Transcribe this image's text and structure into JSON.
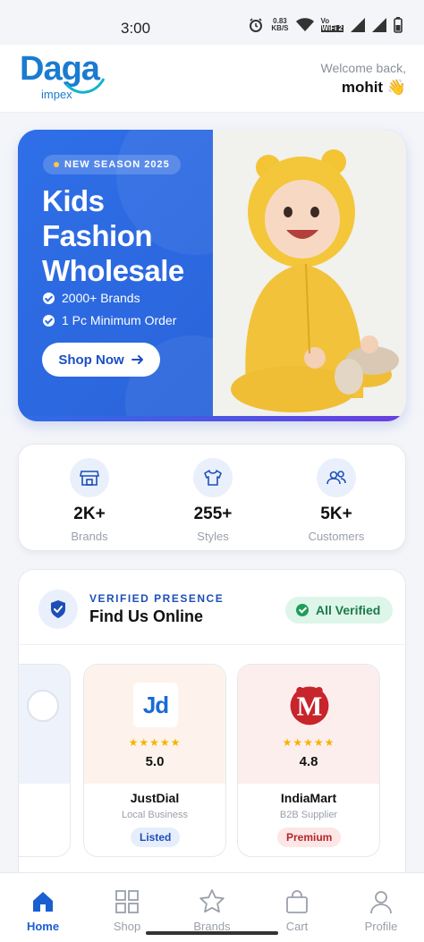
{
  "status_bar": {
    "time": "3:00",
    "net_speed_value": "0.83",
    "net_speed_unit": "KB/S",
    "wifi_label_top": "Vo",
    "wifi_label_bottom": "WiFi 2",
    "icons": [
      "alarm-icon",
      "wifi-icon",
      "vowifi-icon",
      "signal-icon",
      "signal-icon",
      "battery-icon"
    ]
  },
  "header": {
    "logo_main": "Daga",
    "logo_sub": "impex",
    "welcome_line": "Welcome back,",
    "username": "mohit 👋"
  },
  "hero": {
    "season_badge": "NEW SEASON 2025",
    "title_lines": [
      "Kids",
      "Fashion",
      "Wholesale"
    ],
    "features": [
      "2000+ Brands",
      "1 Pc Minimum Order"
    ],
    "cta_label": "Shop Now",
    "cta_icon": "arrow-right-icon",
    "colors": {
      "primary": "#2d6de6",
      "accent_dot": "#ffc83d"
    }
  },
  "stats": [
    {
      "value": "2K+",
      "label": "Brands",
      "icon": "store-icon"
    },
    {
      "value": "255+",
      "label": "Styles",
      "icon": "tshirt-icon"
    },
    {
      "value": "5K+",
      "label": "Customers",
      "icon": "users-icon"
    }
  ],
  "verified": {
    "kicker": "VERIFIED PRESENCE",
    "title": "Find Us Online",
    "badge": "All Verified",
    "cards": [
      {
        "name": "e",
        "subtitle": "ss",
        "tag": "l",
        "stars": "★",
        "rating": ""
      },
      {
        "name": "JustDial",
        "subtitle": "Local Business",
        "tag": "Listed",
        "stars": "★★★★★",
        "rating": "5.0",
        "logo_text": "Jd"
      },
      {
        "name": "IndiaMart",
        "subtitle": "B2B Supplier",
        "tag": "Premium",
        "stars": "★★★★★",
        "rating": "4.8",
        "logo_text": "M"
      }
    ]
  },
  "bottom_nav": [
    {
      "label": "Home",
      "icon": "home-icon",
      "active": true
    },
    {
      "label": "Shop",
      "icon": "grid-icon",
      "active": false
    },
    {
      "label": "Brands",
      "icon": "star-icon",
      "active": false
    },
    {
      "label": "Cart",
      "icon": "bag-icon",
      "active": false
    },
    {
      "label": "Profile",
      "icon": "user-icon",
      "active": false
    }
  ]
}
